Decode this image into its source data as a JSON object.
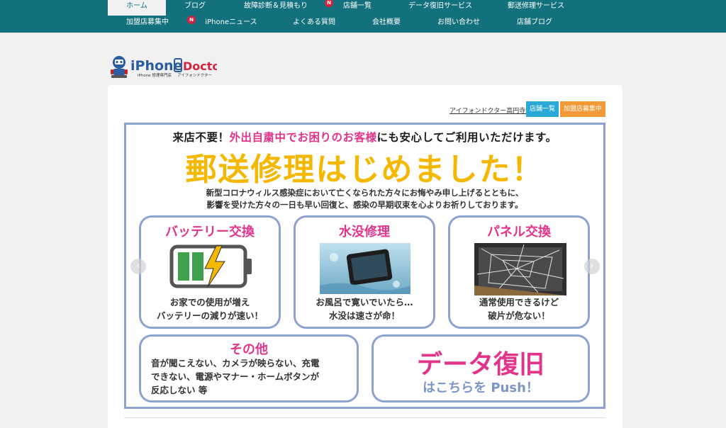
{
  "nav": {
    "row1": [
      "ホーム",
      "ブログ",
      "故障診断＆見積もり",
      "店舗一覧",
      "データ復旧サービス",
      "郵送修理サービス"
    ],
    "row2": [
      "加盟店募集中",
      "iPhoneニュース",
      "よくある質問",
      "会社概要",
      "お問い合わせ",
      "店舗ブログ"
    ],
    "badge": "N"
  },
  "logo": {
    "brand_a": "iPhone",
    "brand_b": "Doctor",
    "sub_a": "iPhone 修理専門店",
    "sub_b": "アイフォンドクター"
  },
  "store": {
    "link": "アイフォンドクター高円寺店",
    "list_button": "店舗一覧",
    "franchise_button": "加盟店募集中"
  },
  "banner": {
    "headline_a": "来店不要！",
    "headline_b": "外出自粛中でお困りのお客様",
    "headline_c": "にも安心してご利用いただけます。",
    "title": "郵送修理はじめました！",
    "message_line1": "新型コロナウィルス感染症において亡くなられた方々にお悔やみ申し上げるとともに、",
    "message_line2": "影響を受けた方々の一日も早い回復と、感染の早期収束を心よりお祈りしております。",
    "services": [
      {
        "title": "バッテリー交換",
        "line1": "お家での使用が増え",
        "line2": "バッテリーの減りが速い！"
      },
      {
        "title": "水没修理",
        "line1": "お風呂で寛いでいたら…",
        "line2": "水没は速さが命！"
      },
      {
        "title": "パネル交換",
        "line1": "通常使用できるけど",
        "line2": "破片が危ない！"
      }
    ],
    "other": {
      "title": "その他",
      "line1": "音が聞こえない、カメラが映らない、充電",
      "line2": "できない、電源やマナー・ホームボタンが",
      "line3": "反応しない 等"
    },
    "data": {
      "title": "データ復旧",
      "sub": "はこちらを Push！"
    },
    "prev": "‹",
    "next": "›"
  },
  "colors": {
    "nav_bg": "#13717d",
    "accent_pink": "#e2348b",
    "accent_yellow": "#f5b800",
    "frame_blue": "#8da3cf",
    "list_blue": "#2aa9d8",
    "franchise_orange": "#f29a35"
  }
}
